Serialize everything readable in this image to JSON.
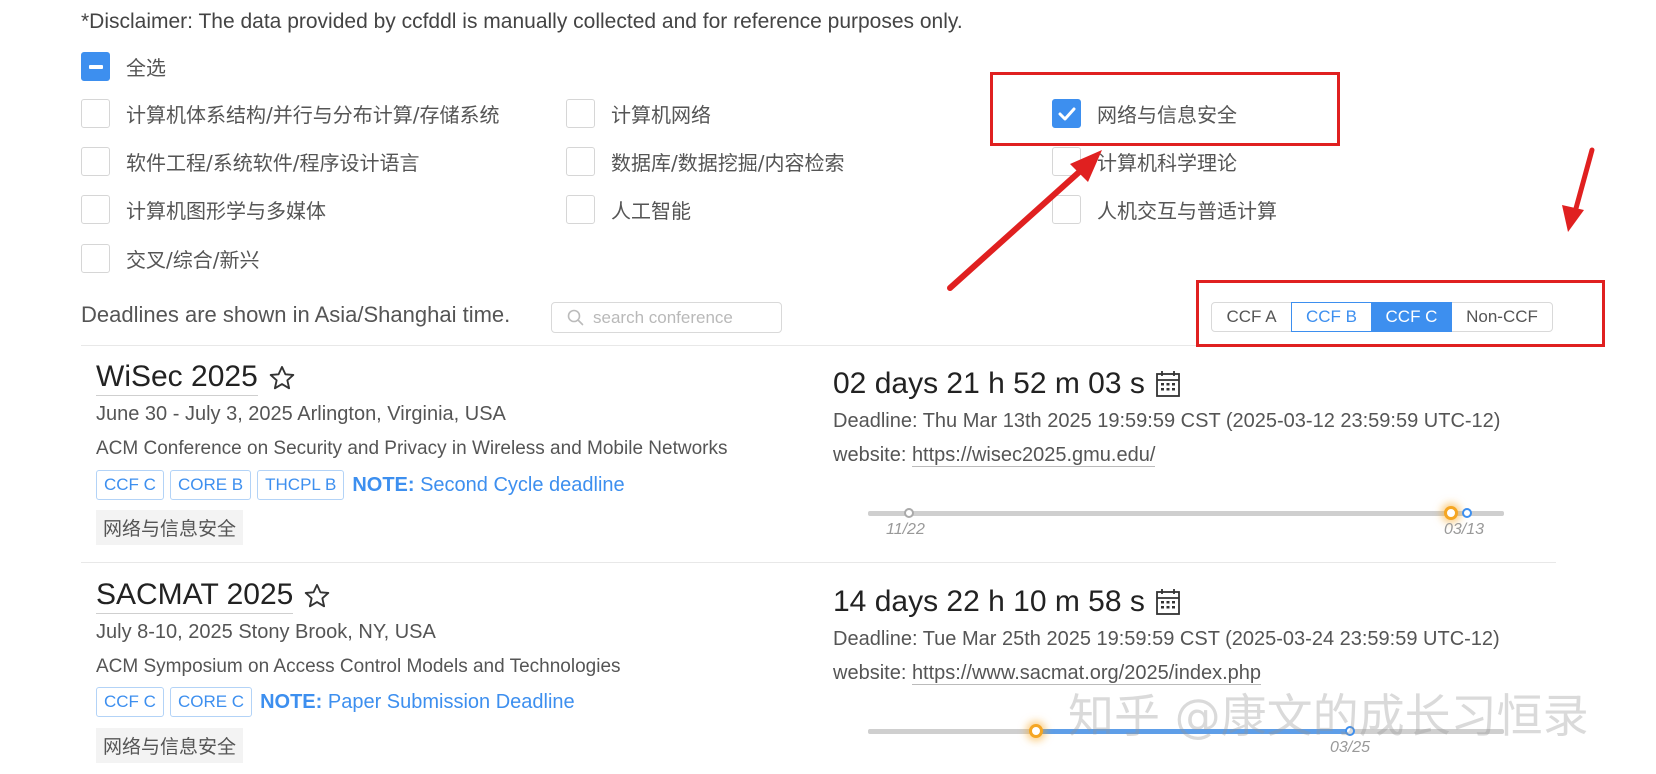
{
  "disclaimer": "*Disclaimer: The data provided by ccfddl is manually collected and for reference purposes only.",
  "categories": {
    "select_all": "全选",
    "items": [
      {
        "label": "计算机体系结构/并行与分布计算/存储系统",
        "checked": false
      },
      {
        "label": "计算机网络",
        "checked": false
      },
      {
        "label": "网络与信息安全",
        "checked": true
      },
      {
        "label": "软件工程/系统软件/程序设计语言",
        "checked": false
      },
      {
        "label": "数据库/数据挖掘/内容检索",
        "checked": false
      },
      {
        "label": "计算机科学理论",
        "checked": false
      },
      {
        "label": "计算机图形学与多媒体",
        "checked": false
      },
      {
        "label": "人工智能",
        "checked": false
      },
      {
        "label": "人机交互与普适计算",
        "checked": false
      },
      {
        "label": "交叉/综合/新兴",
        "checked": false
      }
    ]
  },
  "timezone_text": "Deadlines are shown in Asia/Shanghai time.",
  "search": {
    "placeholder": "search conference"
  },
  "ccf_filter": {
    "options": [
      "CCF A",
      "CCF B",
      "CCF C",
      "Non-CCF"
    ],
    "selected": "CCF C"
  },
  "conferences": [
    {
      "title": "WiSec 2025",
      "date_place": "June 30 - July 3, 2025 Arlington, Virginia, USA",
      "description": "ACM Conference on Security and Privacy in Wireless and Mobile Networks",
      "tags": [
        "CCF C",
        "CORE B",
        "THCPL B"
      ],
      "note_label": "NOTE:",
      "note_text": "Second Cycle deadline",
      "subject": "网络与信息安全",
      "countdown": "02 days 21 h 52 m 03 s",
      "deadline": "Deadline: Thu Mar 13th 2025 19:59:59 CST (2025-03-12 23:59:59 UTC-12)",
      "website_label": "website:",
      "website": "https://wisec2025.gmu.edu/",
      "timeline": {
        "start_label": "11/22",
        "end_label": "03/13",
        "progress": 0.92
      }
    },
    {
      "title": "SACMAT 2025",
      "date_place": "July 8-10, 2025 Stony Brook, NY, USA",
      "description": "ACM Symposium on Access Control Models and Technologies",
      "tags": [
        "CCF C",
        "CORE C"
      ],
      "note_label": "NOTE:",
      "note_text": "Paper Submission Deadline",
      "subject": "网络与信息安全",
      "countdown": "14 days 22 h 10 m 58 s",
      "deadline": "Deadline: Tue Mar 25th 2025 19:59:59 CST (2025-03-24 23:59:59 UTC-12)",
      "website_label": "website:",
      "website": "https://www.sacmat.org/2025/index.php",
      "timeline": {
        "end_label": "03/25",
        "progress": 0.27
      }
    }
  ],
  "watermark": "知乎 @康文的成长习恒录",
  "colors": {
    "accent": "#3d8fef",
    "annotation_red": "#e02020",
    "now_marker": "#f5a623"
  }
}
